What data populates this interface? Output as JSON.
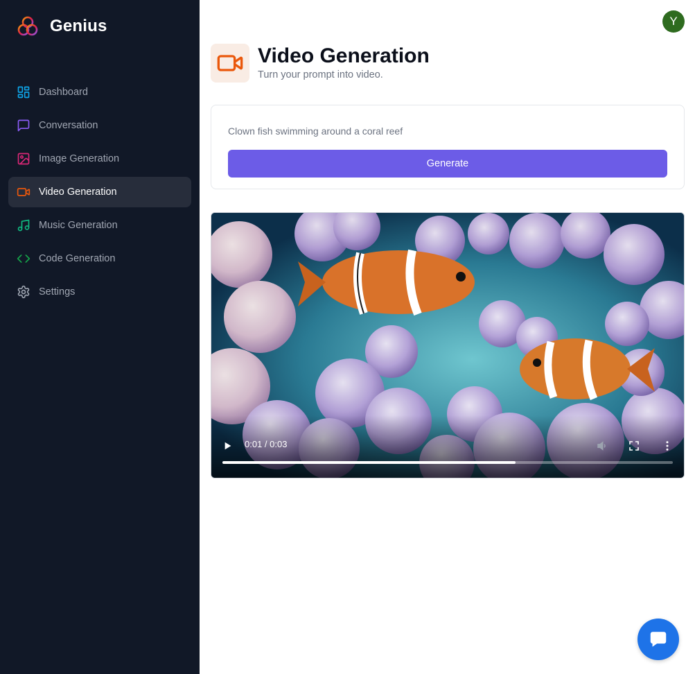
{
  "brand": {
    "name": "Genius"
  },
  "sidebar": {
    "items": [
      {
        "label": "Dashboard",
        "icon": "layout-dashboard-icon",
        "color": "#0ea5e9"
      },
      {
        "label": "Conversation",
        "icon": "message-square-icon",
        "color": "#8b5cf6"
      },
      {
        "label": "Image Generation",
        "icon": "image-icon",
        "color": "#db2777"
      },
      {
        "label": "Video Generation",
        "icon": "video-icon",
        "color": "#ea580c",
        "active": true
      },
      {
        "label": "Music Generation",
        "icon": "music-icon",
        "color": "#10b981"
      },
      {
        "label": "Code Generation",
        "icon": "code-icon",
        "color": "#16a34a"
      },
      {
        "label": "Settings",
        "icon": "settings-icon",
        "color": "#9ca3af"
      }
    ]
  },
  "user": {
    "avatar_initial": "Y",
    "avatar_color": "#2e6b1f"
  },
  "heading": {
    "title": "Video Generation",
    "description": "Turn your prompt into video.",
    "icon": "video-icon",
    "icon_color": "#ea580c",
    "icon_bg": "#f9ece4"
  },
  "form": {
    "prompt_value": "Clown fish swimming around a coral reef",
    "submit_label": "Generate",
    "button_color": "#6c5ce7"
  },
  "video": {
    "current_time": "0:01",
    "duration": "0:03",
    "time_display": "0:01 / 0:03",
    "progress": 0.65,
    "controls": [
      "play-icon",
      "volume-icon",
      "fullscreen-icon",
      "more-vertical-icon"
    ]
  },
  "chat_widget": {
    "icon": "chat-bubble-icon",
    "color": "#1e73e8"
  }
}
